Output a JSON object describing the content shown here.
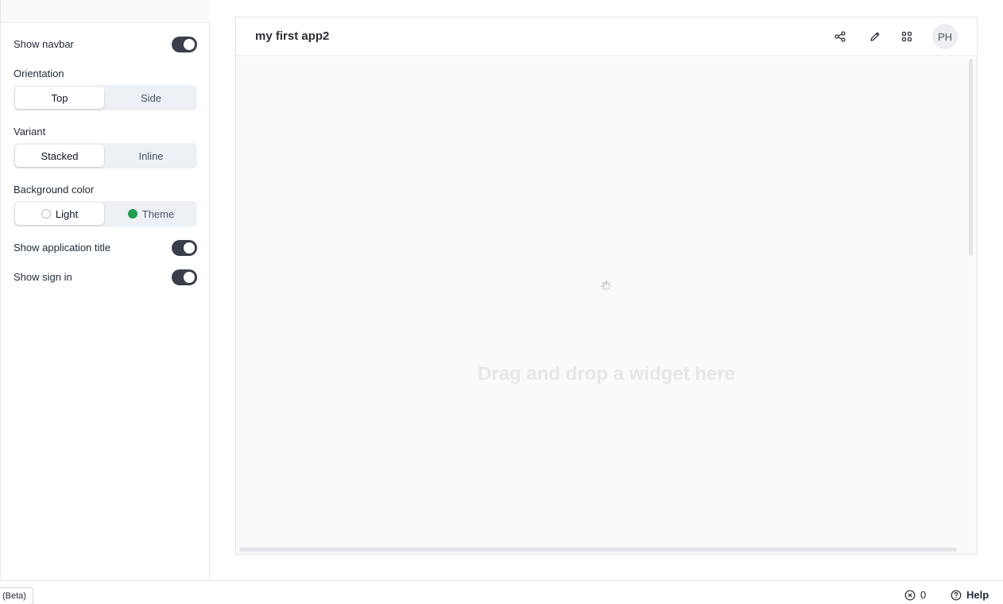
{
  "settings": {
    "show_navbar": {
      "label": "Show navbar",
      "enabled": true
    },
    "orientation": {
      "label": "Orientation",
      "options": [
        "Top",
        "Side"
      ],
      "selected": "Top"
    },
    "variant": {
      "label": "Variant",
      "options": [
        "Stacked",
        "Inline"
      ],
      "selected": "Stacked"
    },
    "background_color": {
      "label": "Background color",
      "options": [
        {
          "label": "Light",
          "swatch": "#ffffff"
        },
        {
          "label": "Theme",
          "swatch": "#1f9e4f"
        }
      ],
      "selected": "Light"
    },
    "show_app_title": {
      "label": "Show application title",
      "enabled": true
    },
    "show_sign_in": {
      "label": "Show sign in",
      "enabled": true
    }
  },
  "preview": {
    "app_title": "my first app2",
    "navbar_icons": [
      "share-icon",
      "pencil-icon",
      "grid-icon"
    ],
    "avatar_initials": "PH",
    "drop_hint": "Drag and drop a widget here"
  },
  "footer": {
    "beta_chip": "(Beta)",
    "error_count": "0",
    "help_label": "Help"
  },
  "colors": {
    "toggle_on": "#3a3f4b",
    "theme_swatch": "#1f9e4f"
  }
}
